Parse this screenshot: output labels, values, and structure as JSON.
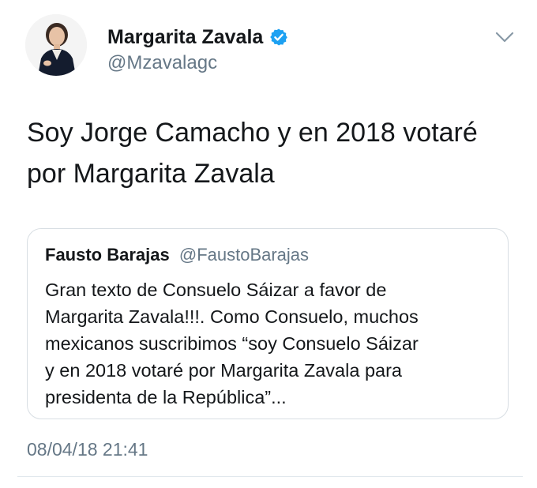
{
  "author": {
    "name": "Margarita Zavala",
    "handle": "@Mzavalagc",
    "verified": true
  },
  "tweet": {
    "text_lines": [
      "Soy Jorge Camacho y en 2018 votaré",
      "por Margarita Zavala"
    ]
  },
  "quoted_tweet": {
    "author_name": "Fausto Barajas",
    "author_handle": "@FaustoBarajas",
    "text_lines": [
      "Gran texto de Consuelo Sáizar a favor de",
      "Margarita Zavala!!!.  Como Consuelo, muchos",
      "mexicanos suscribimos “soy Consuelo Sáizar",
      "y en 2018 votaré por Margarita Zavala para",
      "presidenta de la República”..."
    ]
  },
  "timestamp": "08/04/18 21:41",
  "colors": {
    "text": "#14171a",
    "secondary": "#657786",
    "verified_blue": "#1da1f2",
    "border": "#d8dee3"
  },
  "icons": {
    "verified": "verified-badge-icon",
    "menu": "chevron-down-icon"
  }
}
